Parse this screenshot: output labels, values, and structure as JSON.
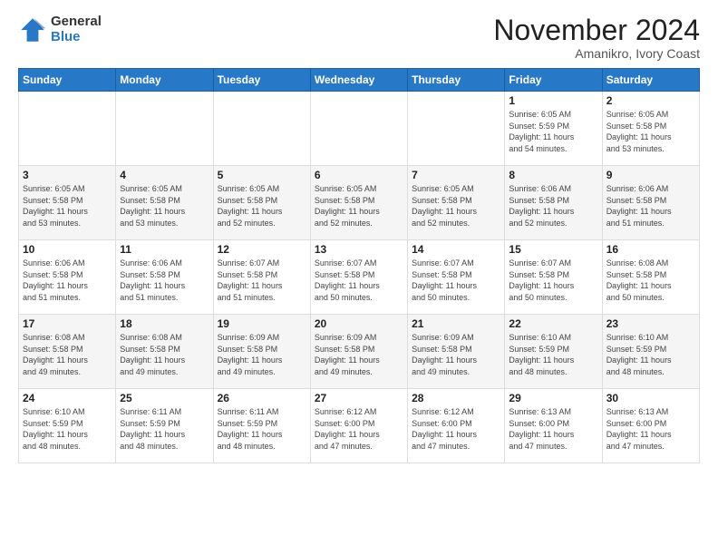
{
  "logo": {
    "general": "General",
    "blue": "Blue"
  },
  "header": {
    "month": "November 2024",
    "location": "Amanikro, Ivory Coast"
  },
  "weekdays": [
    "Sunday",
    "Monday",
    "Tuesday",
    "Wednesday",
    "Thursday",
    "Friday",
    "Saturday"
  ],
  "weeks": [
    [
      {
        "day": "",
        "info": ""
      },
      {
        "day": "",
        "info": ""
      },
      {
        "day": "",
        "info": ""
      },
      {
        "day": "",
        "info": ""
      },
      {
        "day": "",
        "info": ""
      },
      {
        "day": "1",
        "info": "Sunrise: 6:05 AM\nSunset: 5:59 PM\nDaylight: 11 hours\nand 54 minutes."
      },
      {
        "day": "2",
        "info": "Sunrise: 6:05 AM\nSunset: 5:58 PM\nDaylight: 11 hours\nand 53 minutes."
      }
    ],
    [
      {
        "day": "3",
        "info": "Sunrise: 6:05 AM\nSunset: 5:58 PM\nDaylight: 11 hours\nand 53 minutes."
      },
      {
        "day": "4",
        "info": "Sunrise: 6:05 AM\nSunset: 5:58 PM\nDaylight: 11 hours\nand 53 minutes."
      },
      {
        "day": "5",
        "info": "Sunrise: 6:05 AM\nSunset: 5:58 PM\nDaylight: 11 hours\nand 52 minutes."
      },
      {
        "day": "6",
        "info": "Sunrise: 6:05 AM\nSunset: 5:58 PM\nDaylight: 11 hours\nand 52 minutes."
      },
      {
        "day": "7",
        "info": "Sunrise: 6:05 AM\nSunset: 5:58 PM\nDaylight: 11 hours\nand 52 minutes."
      },
      {
        "day": "8",
        "info": "Sunrise: 6:06 AM\nSunset: 5:58 PM\nDaylight: 11 hours\nand 52 minutes."
      },
      {
        "day": "9",
        "info": "Sunrise: 6:06 AM\nSunset: 5:58 PM\nDaylight: 11 hours\nand 51 minutes."
      }
    ],
    [
      {
        "day": "10",
        "info": "Sunrise: 6:06 AM\nSunset: 5:58 PM\nDaylight: 11 hours\nand 51 minutes."
      },
      {
        "day": "11",
        "info": "Sunrise: 6:06 AM\nSunset: 5:58 PM\nDaylight: 11 hours\nand 51 minutes."
      },
      {
        "day": "12",
        "info": "Sunrise: 6:07 AM\nSunset: 5:58 PM\nDaylight: 11 hours\nand 51 minutes."
      },
      {
        "day": "13",
        "info": "Sunrise: 6:07 AM\nSunset: 5:58 PM\nDaylight: 11 hours\nand 50 minutes."
      },
      {
        "day": "14",
        "info": "Sunrise: 6:07 AM\nSunset: 5:58 PM\nDaylight: 11 hours\nand 50 minutes."
      },
      {
        "day": "15",
        "info": "Sunrise: 6:07 AM\nSunset: 5:58 PM\nDaylight: 11 hours\nand 50 minutes."
      },
      {
        "day": "16",
        "info": "Sunrise: 6:08 AM\nSunset: 5:58 PM\nDaylight: 11 hours\nand 50 minutes."
      }
    ],
    [
      {
        "day": "17",
        "info": "Sunrise: 6:08 AM\nSunset: 5:58 PM\nDaylight: 11 hours\nand 49 minutes."
      },
      {
        "day": "18",
        "info": "Sunrise: 6:08 AM\nSunset: 5:58 PM\nDaylight: 11 hours\nand 49 minutes."
      },
      {
        "day": "19",
        "info": "Sunrise: 6:09 AM\nSunset: 5:58 PM\nDaylight: 11 hours\nand 49 minutes."
      },
      {
        "day": "20",
        "info": "Sunrise: 6:09 AM\nSunset: 5:58 PM\nDaylight: 11 hours\nand 49 minutes."
      },
      {
        "day": "21",
        "info": "Sunrise: 6:09 AM\nSunset: 5:58 PM\nDaylight: 11 hours\nand 49 minutes."
      },
      {
        "day": "22",
        "info": "Sunrise: 6:10 AM\nSunset: 5:59 PM\nDaylight: 11 hours\nand 48 minutes."
      },
      {
        "day": "23",
        "info": "Sunrise: 6:10 AM\nSunset: 5:59 PM\nDaylight: 11 hours\nand 48 minutes."
      }
    ],
    [
      {
        "day": "24",
        "info": "Sunrise: 6:10 AM\nSunset: 5:59 PM\nDaylight: 11 hours\nand 48 minutes."
      },
      {
        "day": "25",
        "info": "Sunrise: 6:11 AM\nSunset: 5:59 PM\nDaylight: 11 hours\nand 48 minutes."
      },
      {
        "day": "26",
        "info": "Sunrise: 6:11 AM\nSunset: 5:59 PM\nDaylight: 11 hours\nand 48 minutes."
      },
      {
        "day": "27",
        "info": "Sunrise: 6:12 AM\nSunset: 6:00 PM\nDaylight: 11 hours\nand 47 minutes."
      },
      {
        "day": "28",
        "info": "Sunrise: 6:12 AM\nSunset: 6:00 PM\nDaylight: 11 hours\nand 47 minutes."
      },
      {
        "day": "29",
        "info": "Sunrise: 6:13 AM\nSunset: 6:00 PM\nDaylight: 11 hours\nand 47 minutes."
      },
      {
        "day": "30",
        "info": "Sunrise: 6:13 AM\nSunset: 6:00 PM\nDaylight: 11 hours\nand 47 minutes."
      }
    ]
  ]
}
